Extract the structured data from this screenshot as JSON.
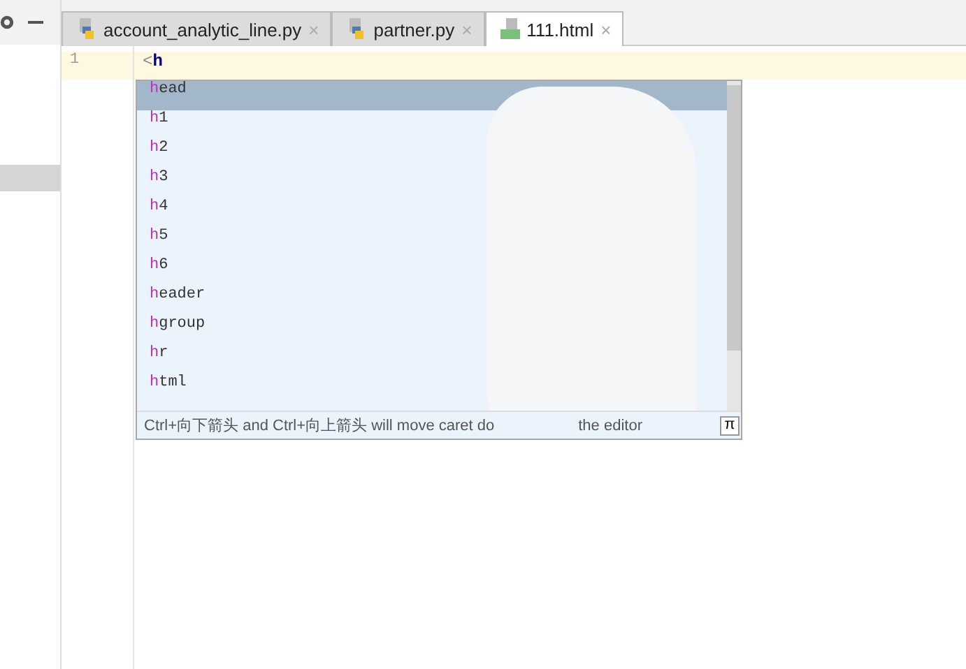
{
  "tabs": [
    {
      "label": "account_analytic_line.py",
      "kind": "python",
      "selected": false,
      "close": "×"
    },
    {
      "label": "partner.py",
      "kind": "python",
      "selected": false,
      "close": "×"
    },
    {
      "label": "111.html",
      "kind": "html",
      "selected": true,
      "close": "×"
    }
  ],
  "editor": {
    "line_number": "1",
    "bracket": "<",
    "typed": "h"
  },
  "completion": {
    "items": [
      {
        "match": "h",
        "rest": "ead",
        "selected": true
      },
      {
        "match": "h",
        "rest": "1",
        "selected": false
      },
      {
        "match": "h",
        "rest": "2",
        "selected": false
      },
      {
        "match": "h",
        "rest": "3",
        "selected": false
      },
      {
        "match": "h",
        "rest": "4",
        "selected": false
      },
      {
        "match": "h",
        "rest": "5",
        "selected": false
      },
      {
        "match": "h",
        "rest": "6",
        "selected": false
      },
      {
        "match": "h",
        "rest": "eader",
        "selected": false
      },
      {
        "match": "h",
        "rest": "group",
        "selected": false
      },
      {
        "match": "h",
        "rest": "r",
        "selected": false
      },
      {
        "match": "h",
        "rest": "tml",
        "selected": false
      }
    ],
    "hint_start": "Ctrl+向下箭头 and Ctrl+向上箭头 will move caret do",
    "hint_end": "the editor",
    "pi_button": "π"
  }
}
